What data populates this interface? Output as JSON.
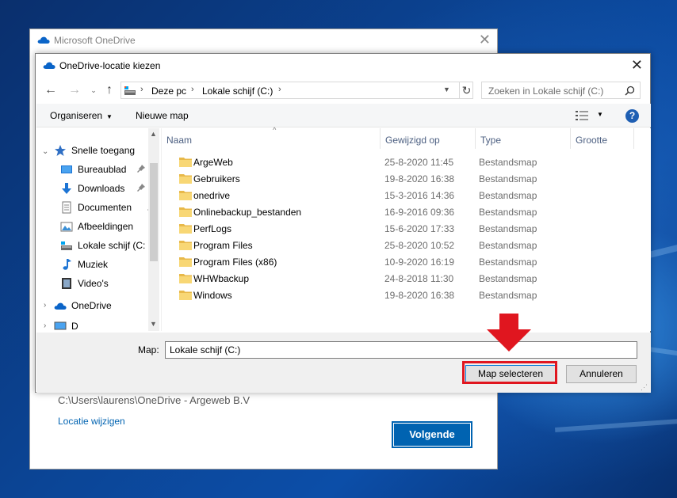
{
  "onedrive_window": {
    "title": "Microsoft OneDrive",
    "close": "✕",
    "path": "C:\\Users\\laurens\\OneDrive - Argeweb B.V",
    "change_location": "Locatie wijzigen",
    "next_button": "Volgende"
  },
  "dialog": {
    "title": "OneDrive-locatie kiezen",
    "close": "✕",
    "nav": {
      "back": "←",
      "forward": "→",
      "recent": "⌄",
      "up": "↑"
    },
    "address": {
      "parts": [
        "Deze pc",
        "Lokale schijf (C:)"
      ],
      "separator": "›",
      "refresh": "↻"
    },
    "search": {
      "placeholder": "Zoeken in Lokale schijf (C:)"
    },
    "commands": {
      "organize": "Organiseren",
      "new_folder": "Nieuwe map",
      "help": "?"
    },
    "navigation_pane": {
      "quick_access": "Snelle toegang",
      "items": [
        {
          "label": "Bureaublad",
          "icon": "desktop-icon",
          "pinned": true
        },
        {
          "label": "Downloads",
          "icon": "download-icon",
          "pinned": true
        },
        {
          "label": "Documenten",
          "icon": "documents-icon",
          "pinned": true
        },
        {
          "label": "Afbeeldingen",
          "icon": "pictures-icon",
          "pinned": true
        },
        {
          "label": "Lokale schijf (C:",
          "icon": "drive-icon",
          "pinned": false
        },
        {
          "label": "Muziek",
          "icon": "music-icon",
          "pinned": false
        },
        {
          "label": "Video's",
          "icon": "video-icon",
          "pinned": false
        }
      ],
      "onedrive": "OneDrive",
      "partial": "D"
    },
    "columns": {
      "name": "Naam",
      "modified": "Gewijzigd op",
      "type": "Type",
      "size": "Grootte"
    },
    "files": [
      {
        "name": "ArgeWeb",
        "modified": "25-8-2020 11:45",
        "type": "Bestandsmap"
      },
      {
        "name": "Gebruikers",
        "modified": "19-8-2020 16:38",
        "type": "Bestandsmap"
      },
      {
        "name": "onedrive",
        "modified": "15-3-2016 14:36",
        "type": "Bestandsmap"
      },
      {
        "name": "Onlinebackup_bestanden",
        "modified": "16-9-2016 09:36",
        "type": "Bestandsmap"
      },
      {
        "name": "PerfLogs",
        "modified": "15-6-2020 17:33",
        "type": "Bestandsmap"
      },
      {
        "name": "Program Files",
        "modified": "25-8-2020 10:52",
        "type": "Bestandsmap"
      },
      {
        "name": "Program Files (x86)",
        "modified": "10-9-2020 16:19",
        "type": "Bestandsmap"
      },
      {
        "name": "WHWbackup",
        "modified": "24-8-2018 11:30",
        "type": "Bestandsmap"
      },
      {
        "name": "Windows",
        "modified": "19-8-2020 16:38",
        "type": "Bestandsmap"
      }
    ],
    "map_label": "Map:",
    "map_value": "Lokale schijf (C:)",
    "select_button": "Map selecteren",
    "cancel_button": "Annuleren"
  },
  "colors": {
    "accent": "#0063b1",
    "highlight": "#e0161f",
    "folder": "#f8d775"
  }
}
